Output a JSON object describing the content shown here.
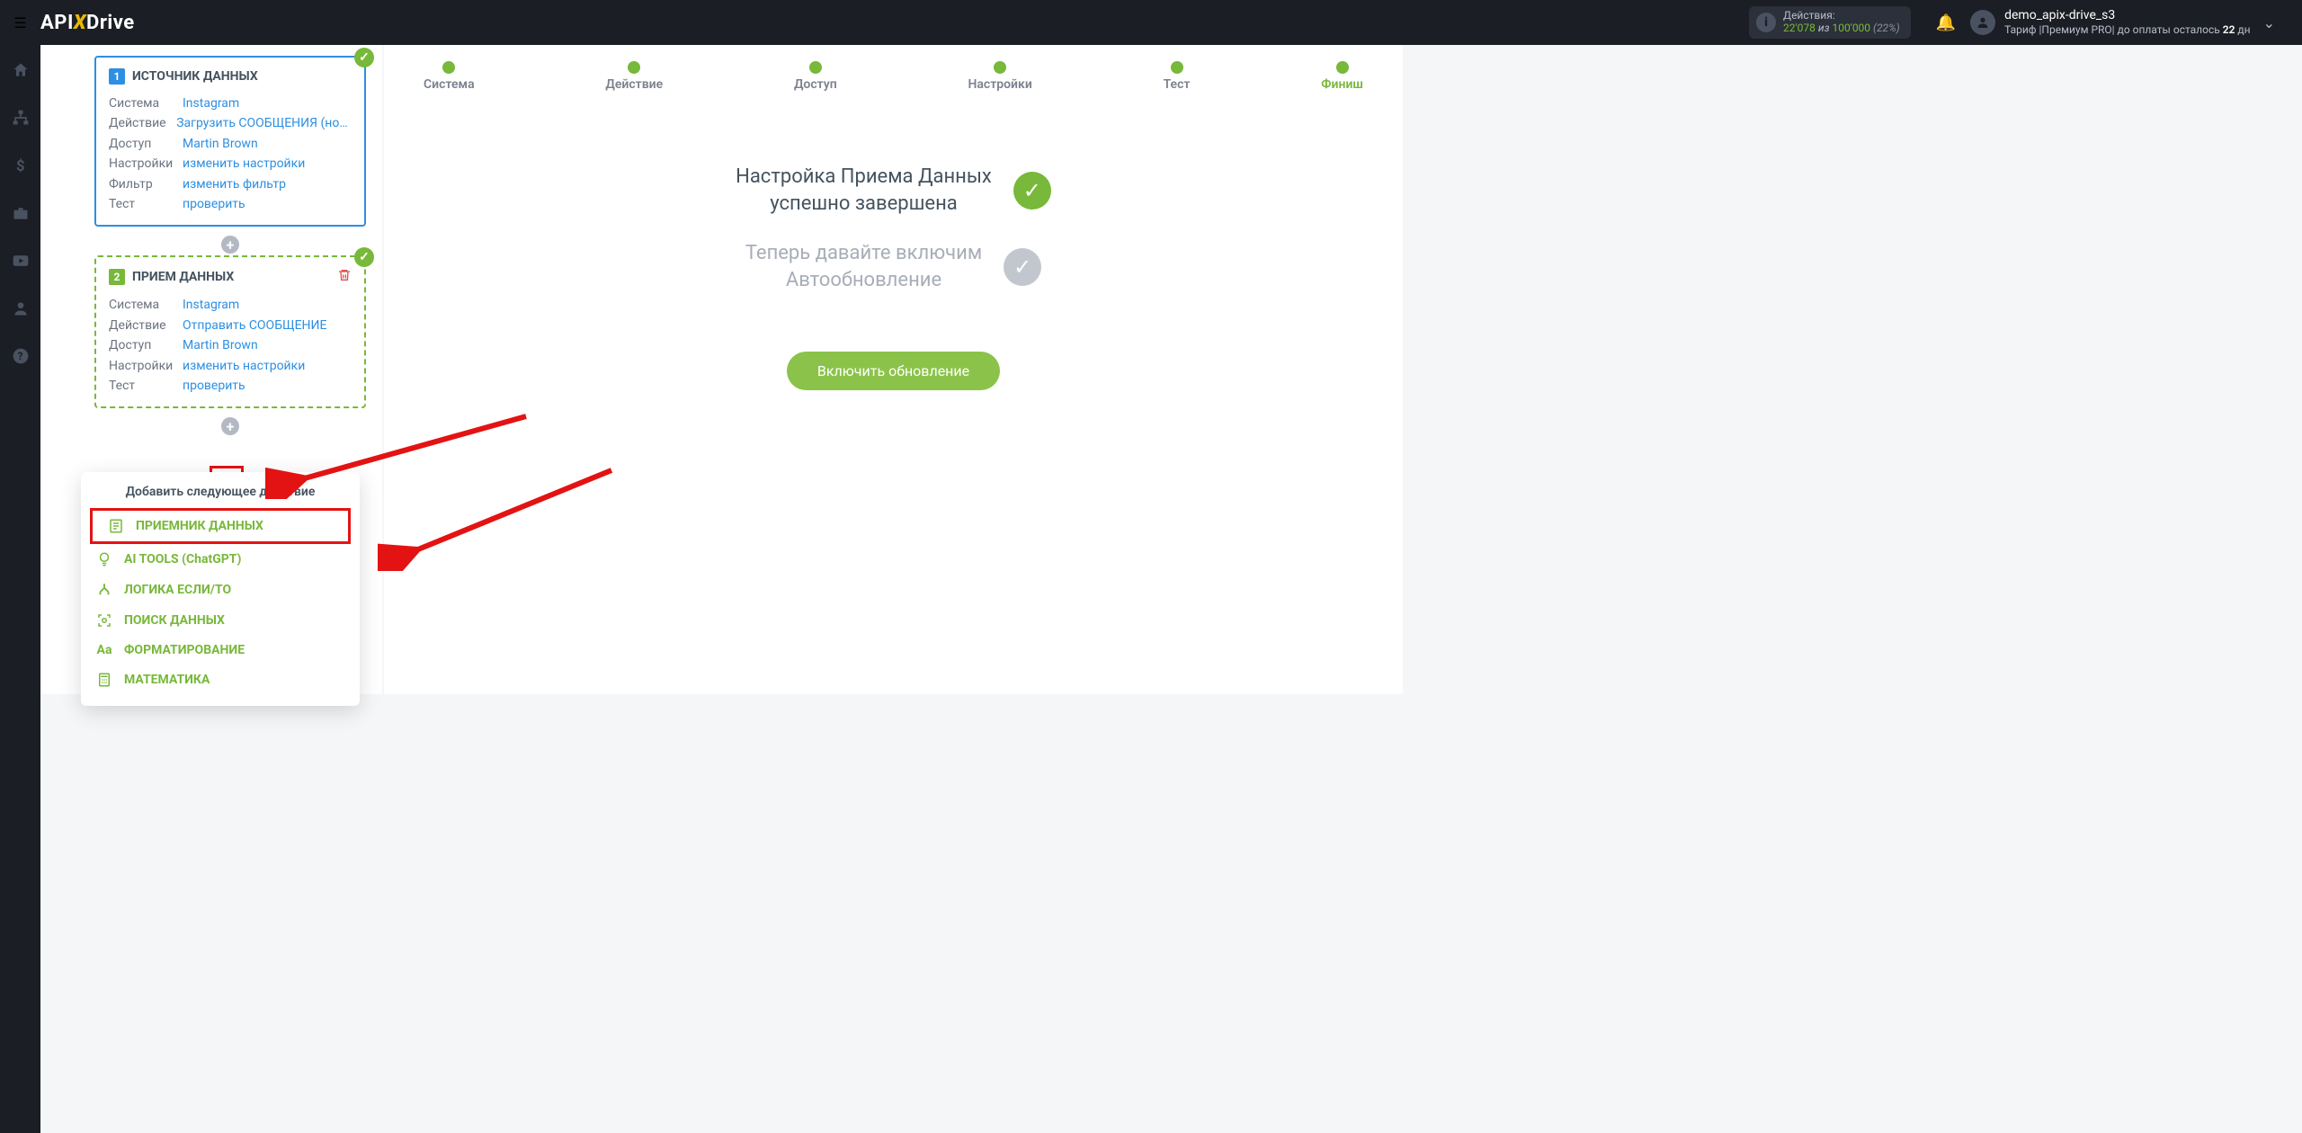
{
  "header": {
    "actions_label": "Действия:",
    "actions_used": "22'078",
    "actions_of": "из",
    "actions_total": "100'000",
    "actions_pct": "(22%)",
    "username": "demo_apix-drive_s3",
    "tariff_prefix": "Тариф |Премиум PRO| до оплаты осталось ",
    "tariff_days": "22",
    "tariff_suffix": " дн"
  },
  "source_card": {
    "title": "ИСТОЧНИК ДАННЫХ",
    "rows": {
      "system_l": "Система",
      "system_v": "Instagram",
      "action_l": "Действие",
      "action_v": "Загрузить СООБЩЕНИЯ (новые)",
      "access_l": "Доступ",
      "access_v": "Martin Brown",
      "settings_l": "Настройки",
      "settings_v": "изменить настройки",
      "filter_l": "Фильтр",
      "filter_v": "изменить фильтр",
      "test_l": "Тест",
      "test_v": "проверить"
    }
  },
  "dest_card": {
    "title": "ПРИЕМ ДАННЫХ",
    "rows": {
      "system_l": "Система",
      "system_v": "Instagram",
      "action_l": "Действие",
      "action_v": "Отправить СООБЩЕНИЕ",
      "access_l": "Доступ",
      "access_v": "Martin Brown",
      "settings_l": "Настройки",
      "settings_v": "изменить настройки",
      "test_l": "Тест",
      "test_v": "проверить"
    }
  },
  "popup": {
    "title": "Добавить следующее действие",
    "items": [
      "ПРИЕМНИК ДАННЫХ",
      "AI TOOLS (ChatGPT)",
      "ЛОГИКА ЕСЛИ/ТО",
      "ПОИСК ДАННЫХ",
      "ФОРМАТИРОВАНИЕ",
      "МАТЕМАТИКА"
    ]
  },
  "steps": [
    "Система",
    "Действие",
    "Доступ",
    "Настройки",
    "Тест",
    "Финиш"
  ],
  "status": {
    "line1a": "Настройка Приема Данных",
    "line1b": "успешно завершена",
    "line2a": "Теперь давайте включим",
    "line2b": "Автообновление",
    "button": "Включить обновление"
  }
}
